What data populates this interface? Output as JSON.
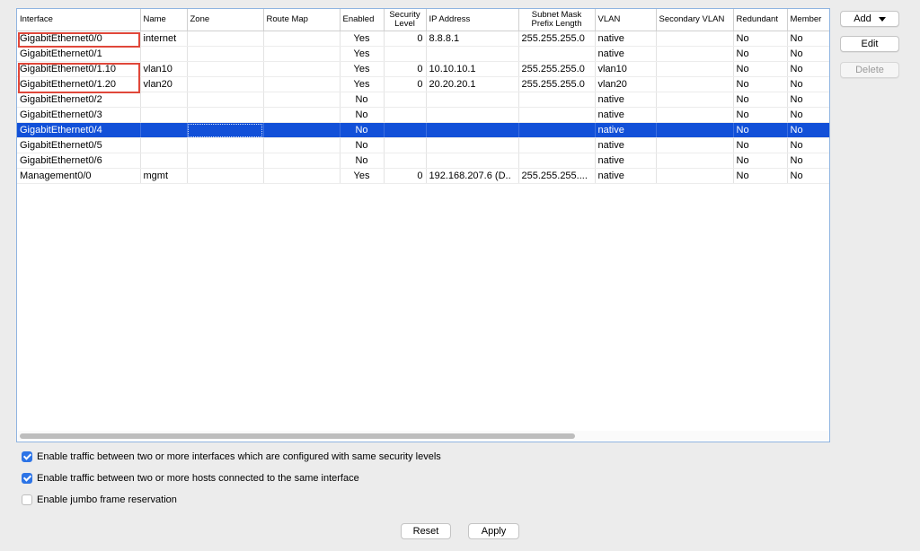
{
  "table": {
    "columns": [
      {
        "label": "Interface"
      },
      {
        "label": "Name"
      },
      {
        "label": "Zone"
      },
      {
        "label": "Route Map"
      },
      {
        "label": "Enabled"
      },
      {
        "label": "Security Level"
      },
      {
        "label": "IP Address"
      },
      {
        "label": "Subnet Mask Prefix Length"
      },
      {
        "label": "VLAN"
      },
      {
        "label": "Secondary VLAN"
      },
      {
        "label": "Redundant"
      },
      {
        "label": "Member"
      }
    ],
    "rows": [
      {
        "interface": "GigabitEthernet0/0",
        "name": "internet",
        "zone": "",
        "route_map": "",
        "enabled": "Yes",
        "security_level": "0",
        "ip": "8.8.8.1",
        "mask": "255.255.255.0",
        "vlan": "native",
        "secondary_vlan": "",
        "redundant": "No",
        "member": "No",
        "selected": false,
        "highlighted": true
      },
      {
        "interface": "GigabitEthernet0/1",
        "name": "",
        "zone": "",
        "route_map": "",
        "enabled": "Yes",
        "security_level": "",
        "ip": "",
        "mask": "",
        "vlan": "native",
        "secondary_vlan": "",
        "redundant": "No",
        "member": "No",
        "selected": false,
        "highlighted": false
      },
      {
        "interface": "GigabitEthernet0/1.10",
        "name": "vlan10",
        "zone": "",
        "route_map": "",
        "enabled": "Yes",
        "security_level": "0",
        "ip": "10.10.10.1",
        "mask": "255.255.255.0",
        "vlan": "vlan10",
        "secondary_vlan": "",
        "redundant": "No",
        "member": "No",
        "selected": false,
        "highlighted": true
      },
      {
        "interface": "GigabitEthernet0/1.20",
        "name": "vlan20",
        "zone": "",
        "route_map": "",
        "enabled": "Yes",
        "security_level": "0",
        "ip": "20.20.20.1",
        "mask": "255.255.255.0",
        "vlan": "vlan20",
        "secondary_vlan": "",
        "redundant": "No",
        "member": "No",
        "selected": false,
        "highlighted": true
      },
      {
        "interface": "GigabitEthernet0/2",
        "name": "",
        "zone": "",
        "route_map": "",
        "enabled": "No",
        "security_level": "",
        "ip": "",
        "mask": "",
        "vlan": "native",
        "secondary_vlan": "",
        "redundant": "No",
        "member": "No",
        "selected": false,
        "highlighted": false
      },
      {
        "interface": "GigabitEthernet0/3",
        "name": "",
        "zone": "",
        "route_map": "",
        "enabled": "No",
        "security_level": "",
        "ip": "",
        "mask": "",
        "vlan": "native",
        "secondary_vlan": "",
        "redundant": "No",
        "member": "No",
        "selected": false,
        "highlighted": false
      },
      {
        "interface": "GigabitEthernet0/4",
        "name": "",
        "zone": "",
        "route_map": "",
        "enabled": "No",
        "security_level": "",
        "ip": "",
        "mask": "",
        "vlan": "native",
        "secondary_vlan": "",
        "redundant": "No",
        "member": "No",
        "selected": true,
        "highlighted": false
      },
      {
        "interface": "GigabitEthernet0/5",
        "name": "",
        "zone": "",
        "route_map": "",
        "enabled": "No",
        "security_level": "",
        "ip": "",
        "mask": "",
        "vlan": "native",
        "secondary_vlan": "",
        "redundant": "No",
        "member": "No",
        "selected": false,
        "highlighted": false
      },
      {
        "interface": "GigabitEthernet0/6",
        "name": "",
        "zone": "",
        "route_map": "",
        "enabled": "No",
        "security_level": "",
        "ip": "",
        "mask": "",
        "vlan": "native",
        "secondary_vlan": "",
        "redundant": "No",
        "member": "No",
        "selected": false,
        "highlighted": false
      },
      {
        "interface": "Management0/0",
        "name": "mgmt",
        "zone": "",
        "route_map": "",
        "enabled": "Yes",
        "security_level": "0",
        "ip": "192.168.207.6 (D..",
        "mask": "255.255.255....",
        "vlan": "native",
        "secondary_vlan": "",
        "redundant": "No",
        "member": "No",
        "selected": false,
        "highlighted": false
      }
    ]
  },
  "side_buttons": {
    "add_label": "Add",
    "edit_label": "Edit",
    "delete_label": "Delete"
  },
  "options": [
    {
      "label": "Enable traffic between two or more interfaces which are configured with same security levels",
      "checked": true
    },
    {
      "label": "Enable traffic between two or more hosts connected to the same interface",
      "checked": true
    },
    {
      "label": "Enable jumbo frame reservation",
      "checked": false
    }
  ],
  "footer": {
    "reset_label": "Reset",
    "apply_label": "Apply"
  },
  "colors": {
    "selection": "#1250d8",
    "highlight_box": "#e0473a",
    "checkbox_on": "#2d74e6"
  }
}
